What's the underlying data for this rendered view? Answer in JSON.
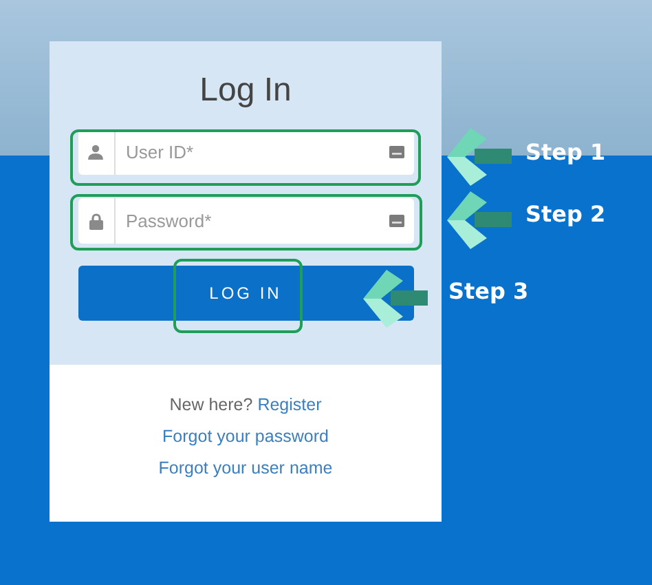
{
  "login_card": {
    "title": "Log In",
    "fields": [
      {
        "kind": "user",
        "placeholder": "User ID*"
      },
      {
        "kind": "password",
        "placeholder": "Password*"
      }
    ],
    "button": "LOG IN",
    "register_prompt": "New here?",
    "register_link": "Register",
    "links": [
      "Forgot your password",
      "Forgot your user name"
    ]
  },
  "steps": [
    {
      "label": "Step 1"
    },
    {
      "label": "Step 2"
    },
    {
      "label": "Step 3"
    }
  ]
}
